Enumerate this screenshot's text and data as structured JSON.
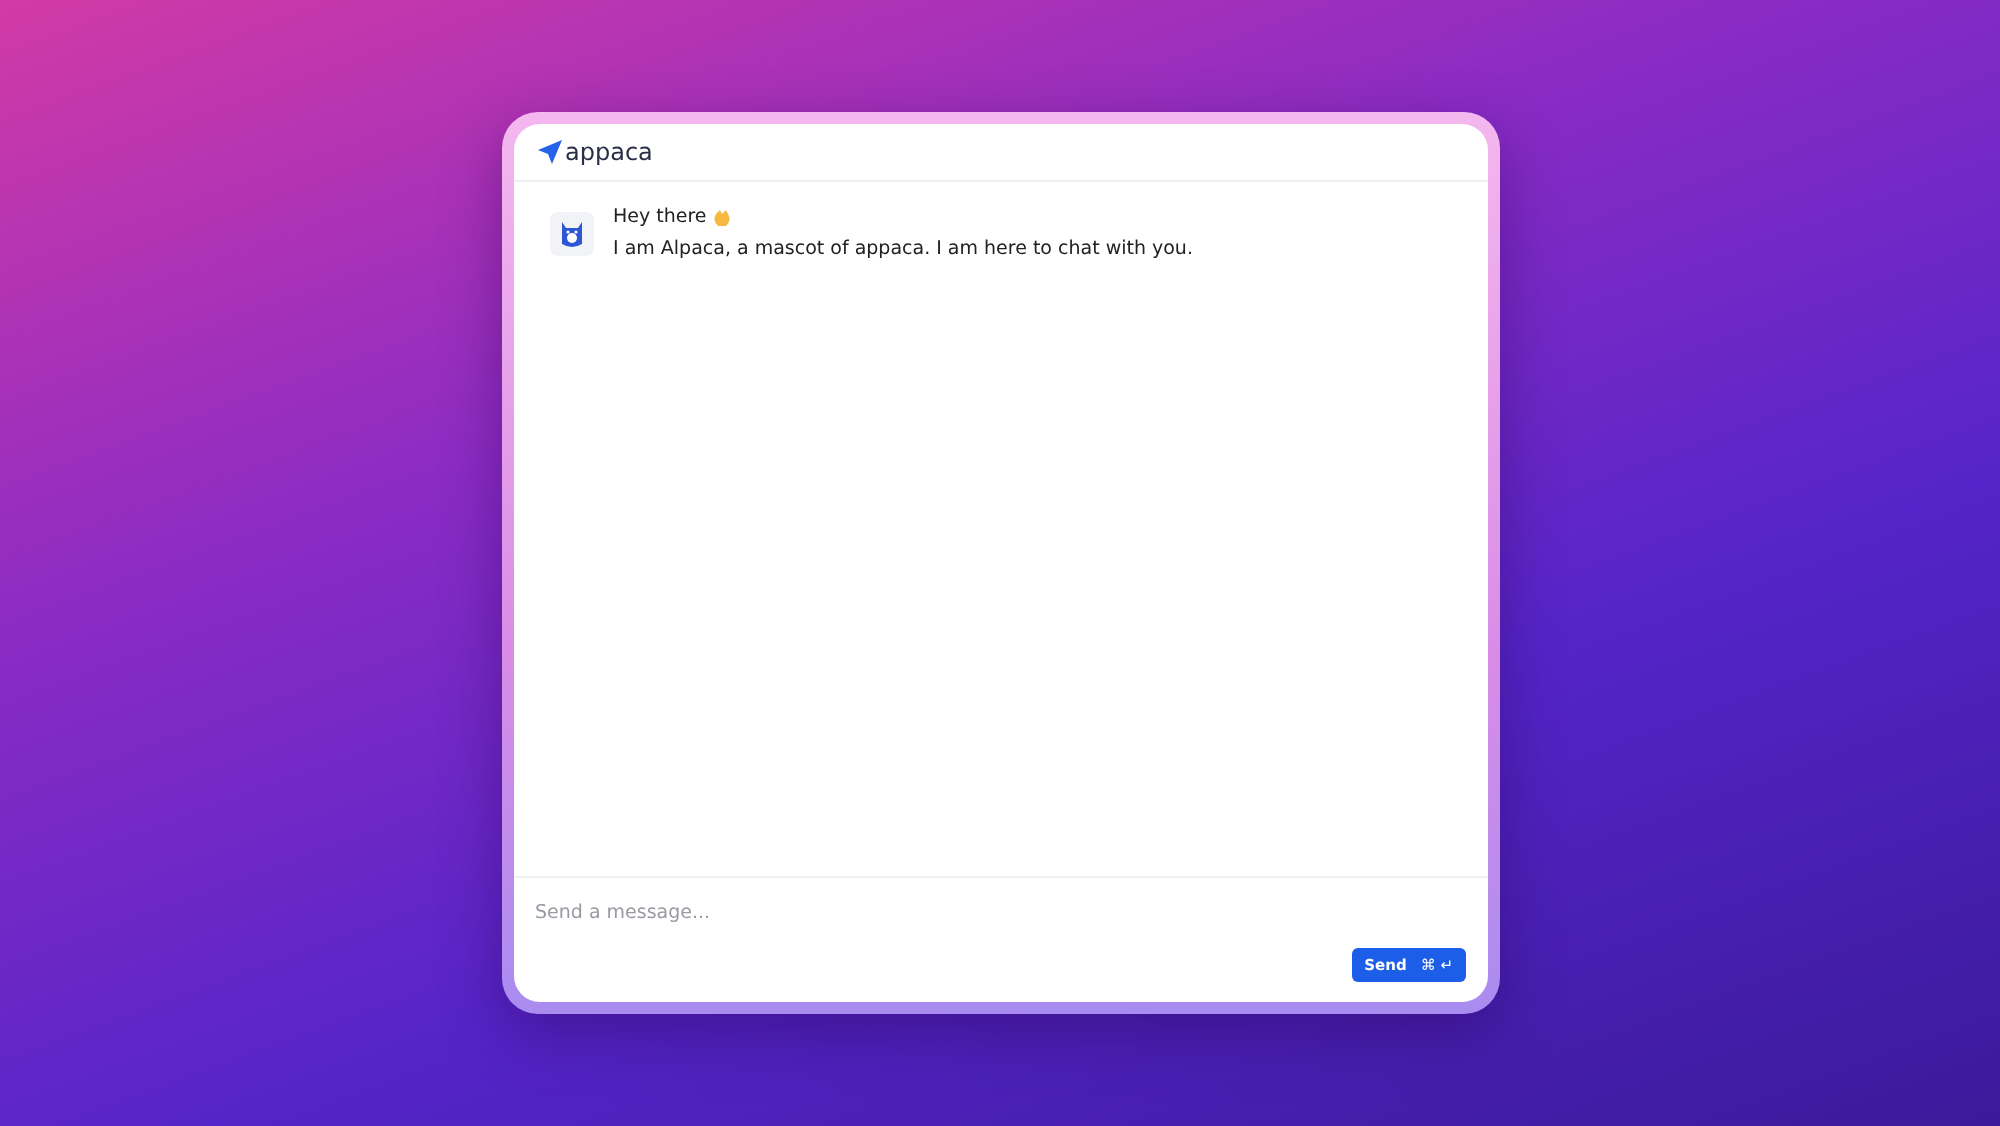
{
  "brand": {
    "name": "appaca"
  },
  "messages": [
    {
      "title": "Hey there",
      "text": "I am Alpaca, a mascot of appaca. I am here to chat with you."
    }
  ],
  "composer": {
    "placeholder": "Send a message...",
    "button": "Send",
    "shortcut": "⌘ ↵"
  }
}
